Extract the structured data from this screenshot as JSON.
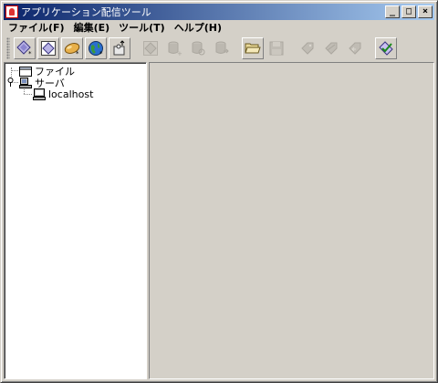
{
  "window": {
    "title": "アプリケーション配信ツール",
    "minimize_label": "_",
    "maximize_label": "□",
    "close_label": "×"
  },
  "menu": [
    {
      "label": "ファイル(F)"
    },
    {
      "label": "編集(E)"
    },
    {
      "label": "ツール(T)"
    },
    {
      "label": "ヘルプ(H)"
    }
  ],
  "toolbar": {
    "buttons": [
      {
        "icon": "diamond-new-icon",
        "enabled": true
      },
      {
        "icon": "diamond-frame-icon",
        "enabled": true
      },
      {
        "icon": "capsule-icon",
        "enabled": true
      },
      {
        "icon": "globe-icon",
        "enabled": true
      },
      {
        "icon": "puzzle-upload-icon",
        "enabled": true
      },
      {
        "icon": "diamond-gray-icon",
        "enabled": false
      },
      {
        "icon": "database-add-icon",
        "enabled": false
      },
      {
        "icon": "database-refresh-icon",
        "enabled": false
      },
      {
        "icon": "database-export-icon",
        "enabled": false
      },
      {
        "icon": "open-folder-icon",
        "enabled": true
      },
      {
        "icon": "save-disk-icon",
        "enabled": false
      },
      {
        "icon": "tag-add-icon",
        "enabled": false
      },
      {
        "icon": "tag-edit-icon",
        "enabled": false
      },
      {
        "icon": "tag-back-icon",
        "enabled": false
      },
      {
        "icon": "checklist-icon",
        "enabled": true
      }
    ]
  },
  "tree": {
    "file_label": "ファイル",
    "server_label": "サーバ",
    "host_label": "localhost"
  },
  "colors": {
    "titlebar_start": "#0a246a",
    "titlebar_end": "#a6caf0",
    "face": "#d4d0c8"
  }
}
